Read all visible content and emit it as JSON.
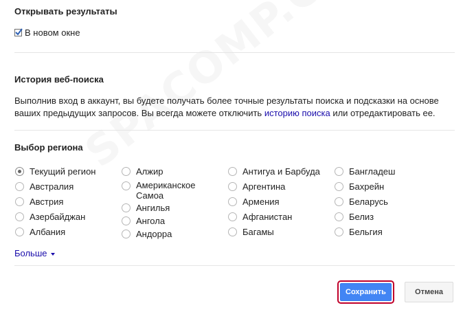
{
  "open_results": {
    "title": "Открывать результаты",
    "new_window_label": "В новом окне",
    "new_window_checked": true
  },
  "search_history": {
    "title": "История веб-поиска",
    "text_before_link": "Выполнив вход в аккаунт, вы будете получать более точные результаты поиска и подсказки на основе ваших предыдущих запросов. Вы всегда можете отключить ",
    "link_text": "историю поиска",
    "text_after_link": " или отредактировать ее."
  },
  "region": {
    "title": "Выбор региона",
    "columns": [
      [
        "Текущий регион",
        "Австралия",
        "Австрия",
        "Азербайджан",
        "Албания"
      ],
      [
        "Алжир",
        "Американское Самоа",
        "Ангилья",
        "Ангола",
        "Андорра"
      ],
      [
        "Антигуа и Барбуда",
        "Аргентина",
        "Армения",
        "Афганистан",
        "Багамы"
      ],
      [
        "Бангладеш",
        "Бахрейн",
        "Беларусь",
        "Белиз",
        "Бельгия"
      ]
    ],
    "selected": "Текущий регион",
    "more_label": "Больше"
  },
  "buttons": {
    "save_label": "Сохранить",
    "cancel_label": "Отмена"
  },
  "watermark": "SPACOMP.COM",
  "colors": {
    "link": "#1a0dab",
    "primary_button": "#4285f4",
    "highlight_outline": "#c0002a"
  }
}
